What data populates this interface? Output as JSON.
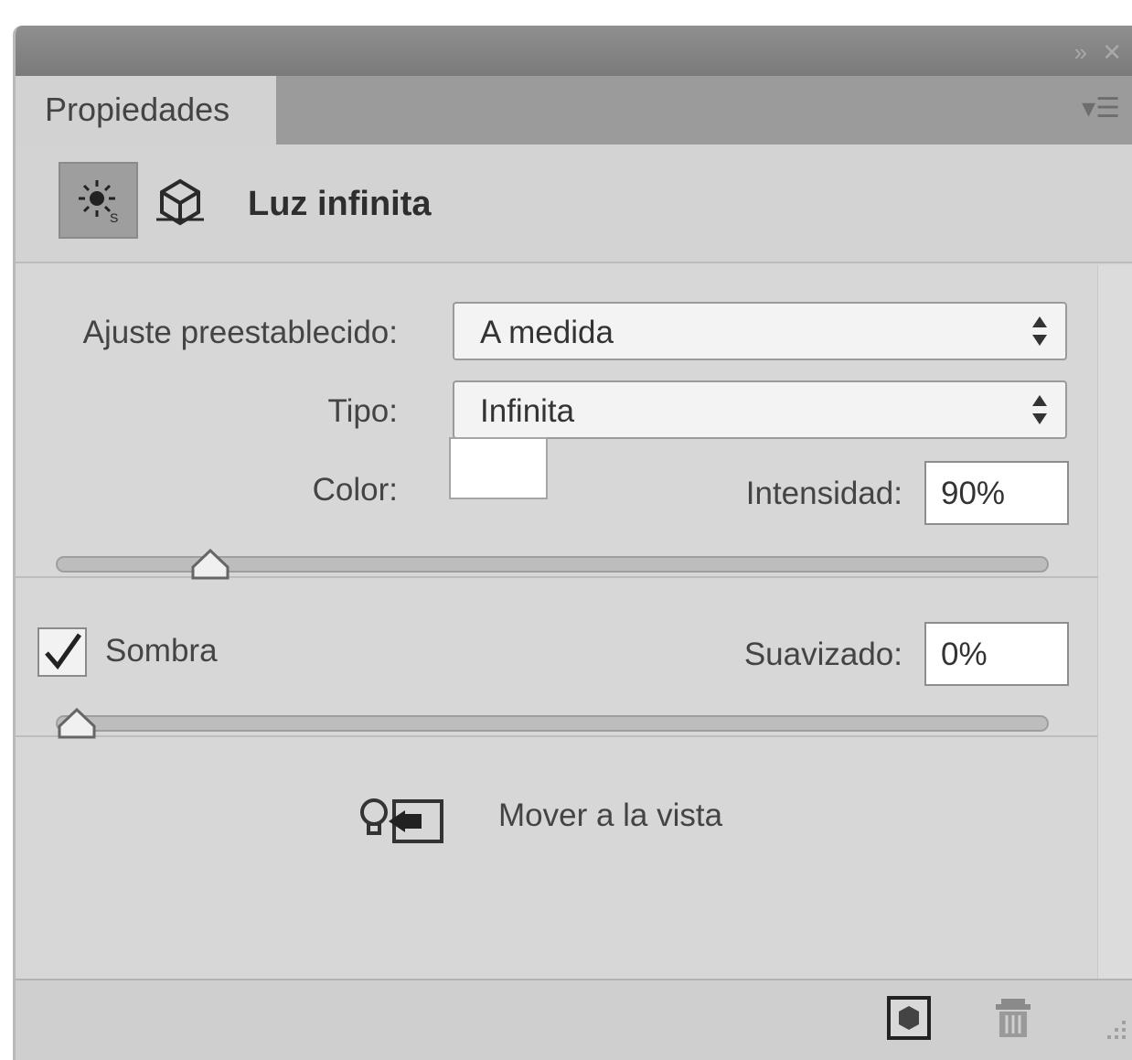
{
  "panel": {
    "tab_label": "Propiedades",
    "header_title": "Luz infinita"
  },
  "light": {
    "preset_label": "Ajuste preestablecido:",
    "preset_value": "A medida",
    "type_label": "Tipo:",
    "type_value": "Infinita",
    "color_label": "Color:",
    "color_value": "#ffffff",
    "intensity_label": "Intensidad:",
    "intensity_value": "90%",
    "intensity_slider_fraction": 0.14
  },
  "shadow": {
    "label": "Sombra",
    "checked": true,
    "softness_label": "Suavizado:",
    "softness_value": "0%",
    "softness_slider_fraction": 0.0
  },
  "actions": {
    "move_to_view_label": "Mover a la vista"
  },
  "icons": {
    "titlebar": [
      "collapse-icon",
      "close-icon"
    ],
    "header": [
      "infinite-light-icon",
      "coordinates-icon"
    ],
    "bottom": [
      "render-icon",
      "trash-icon",
      "resize-grip-icon"
    ]
  }
}
